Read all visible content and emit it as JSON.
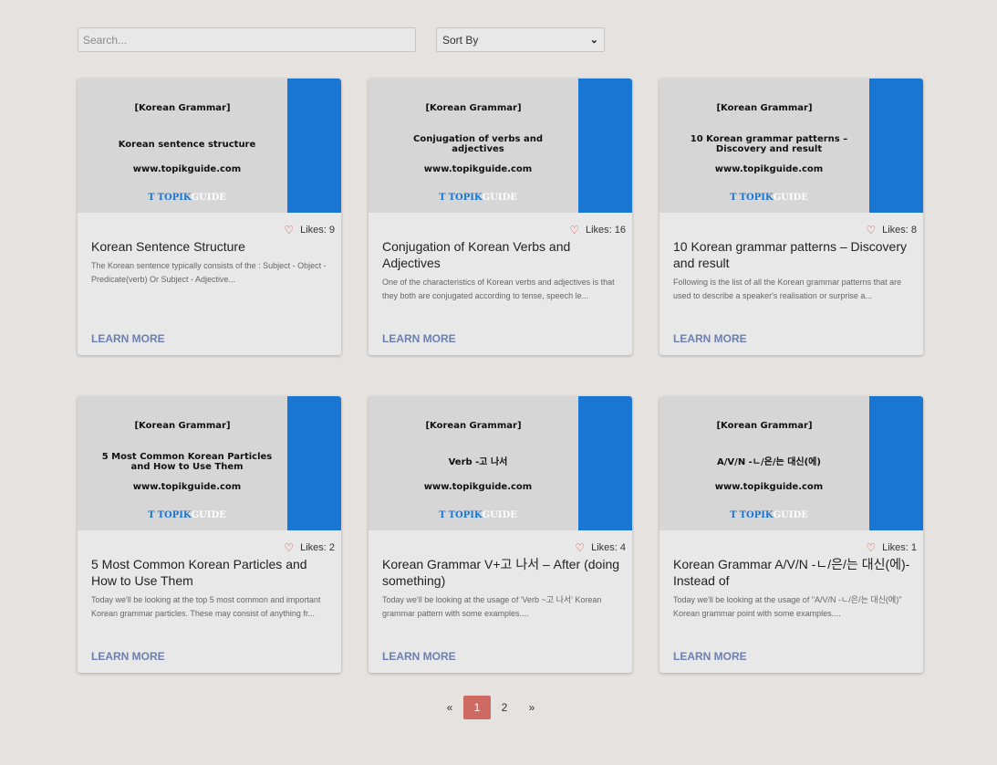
{
  "search": {
    "placeholder": "Search...",
    "value": ""
  },
  "sort": {
    "selected": "Sort By"
  },
  "logo": {
    "mark": "T",
    "part1": "TOPIK",
    "part2": "GUIDE"
  },
  "cards": [
    {
      "thumb": {
        "category": "[Korean Grammar]",
        "title": "Korean sentence structure",
        "url": "www.topikguide.com"
      },
      "likes": "Likes: 9",
      "title": "Korean Sentence Structure",
      "excerpt": "The Korean sentence typically consists of the : Subject - Object - Predicate(verb) Or Subject - Adjective...",
      "cta": "LEARN MORE"
    },
    {
      "thumb": {
        "category": "[Korean Grammar]",
        "title": "Conjugation of verbs and adjectives",
        "url": "www.topikguide.com"
      },
      "likes": "Likes: 16",
      "title": "Conjugation of Korean Verbs and Adjectives",
      "excerpt": "One of the characteristics of Korean verbs and adjectives is that they both are conjugated according to tense, speech le...",
      "cta": "LEARN MORE"
    },
    {
      "thumb": {
        "category": "[Korean Grammar]",
        "title": "10 Korean grammar patterns – Discovery and result",
        "url": "www.topikguide.com"
      },
      "likes": "Likes: 8",
      "title": "10 Korean grammar patterns – Discovery and result",
      "excerpt": "Following is the list of all the Korean grammar patterns that are used to describe a speaker's realisation or surprise a...",
      "cta": "LEARN MORE"
    },
    {
      "thumb": {
        "category": "[Korean Grammar]",
        "title": "5 Most Common Korean Particles and How to Use Them",
        "url": "www.topikguide.com"
      },
      "likes": "Likes: 2",
      "title": "5 Most Common Korean Particles and How to Use Them",
      "excerpt": "Today we'll be looking at the top 5 most common and important Korean grammar particles. These may consist of anything fr...",
      "cta": "LEARN MORE"
    },
    {
      "thumb": {
        "category": "[Korean Grammar]",
        "title": "Verb -고 나서",
        "url": "www.topikguide.com"
      },
      "likes": "Likes: 4",
      "title": "Korean Grammar V+고 나서 – After (doing something)",
      "excerpt": "Today we'll be looking at the usage of 'Verb ~고 나서' Korean grammar pattern with some examples....",
      "cta": "LEARN MORE"
    },
    {
      "thumb": {
        "category": "[Korean Grammar]",
        "title": "A/V/N -ㄴ/은/는 대신(에)",
        "url": "www.topikguide.com"
      },
      "likes": "Likes: 1",
      "title": "Korean Grammar A/V/N -ㄴ/은/는 대신(에)- Instead of",
      "excerpt": "Today we'll be looking at the usage of \"A/V/N -ㄴ/은/는 대신(에)\" Korean grammar point with some examples....",
      "cta": "LEARN MORE"
    }
  ],
  "pagination": {
    "prev": "«",
    "pages": [
      "1",
      "2"
    ],
    "active": "1",
    "next": "»"
  },
  "colors": {
    "accent": "#1976d2",
    "active_page": "#cd6a63",
    "link": "#6b7fb0",
    "heart": "#dd4444"
  }
}
